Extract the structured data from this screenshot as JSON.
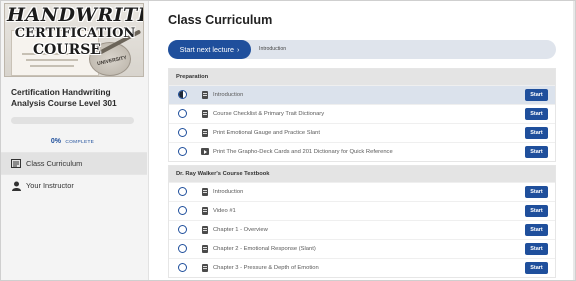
{
  "logo": {
    "line1": "HANDWRITING",
    "line2": "CERTIFICATION",
    "line3": "COURSE",
    "seal_text": "UNIVERSITY"
  },
  "sidebar": {
    "course_title": "Certification Handwriting Analysis Course Level 301",
    "progress": {
      "percent_value": 0,
      "percent_text": "0%",
      "complete_word": "COMPLETE"
    },
    "nav": [
      {
        "label": "Class Curriculum",
        "icon": "curriculum-icon",
        "active": true
      },
      {
        "label": "Your Instructor",
        "icon": "user-icon",
        "active": false
      }
    ]
  },
  "main": {
    "title": "Class Curriculum",
    "next_button_label": "Start next lecture",
    "next_button_arrow": "›",
    "next_lecture": "Introduction",
    "sections": [
      {
        "title": "Preparation",
        "lectures": [
          {
            "title": "Introduction",
            "icon": "document-icon",
            "status": "in-progress",
            "button": "Start"
          },
          {
            "title": "Course Checklist & Primary Trait Dictionary",
            "icon": "document-icon",
            "status": "not-started",
            "button": "Start"
          },
          {
            "title": "Print Emotional Gauge and Practice Slant",
            "icon": "document-icon",
            "status": "not-started",
            "button": "Start"
          },
          {
            "title": "Print The Grapho-Deck Cards and 201 Dictionary for Quick Reference",
            "icon": "video-icon",
            "status": "not-started",
            "button": "Start"
          }
        ]
      },
      {
        "title": "Dr. Ray Walker's Course Textbook",
        "lectures": [
          {
            "title": "Introduction",
            "icon": "document-icon",
            "status": "not-started",
            "button": "Start"
          },
          {
            "title": "Video #1",
            "icon": "document-icon",
            "status": "not-started",
            "button": "Start"
          },
          {
            "title": "Chapter 1 - Overview",
            "icon": "document-icon",
            "status": "not-started",
            "button": "Start"
          },
          {
            "title": "Chapter 2 - Emotional Response (Slant)",
            "icon": "document-icon",
            "status": "not-started",
            "button": "Start"
          },
          {
            "title": "Chapter 3 - Pressure & Depth of Emotion",
            "icon": "document-icon",
            "status": "not-started",
            "button": "Start"
          }
        ]
      }
    ]
  },
  "colors": {
    "accent": "#1f4f9c",
    "section_header_bg": "#e4e4e4",
    "current_row_bg": "#dbe2ec"
  }
}
